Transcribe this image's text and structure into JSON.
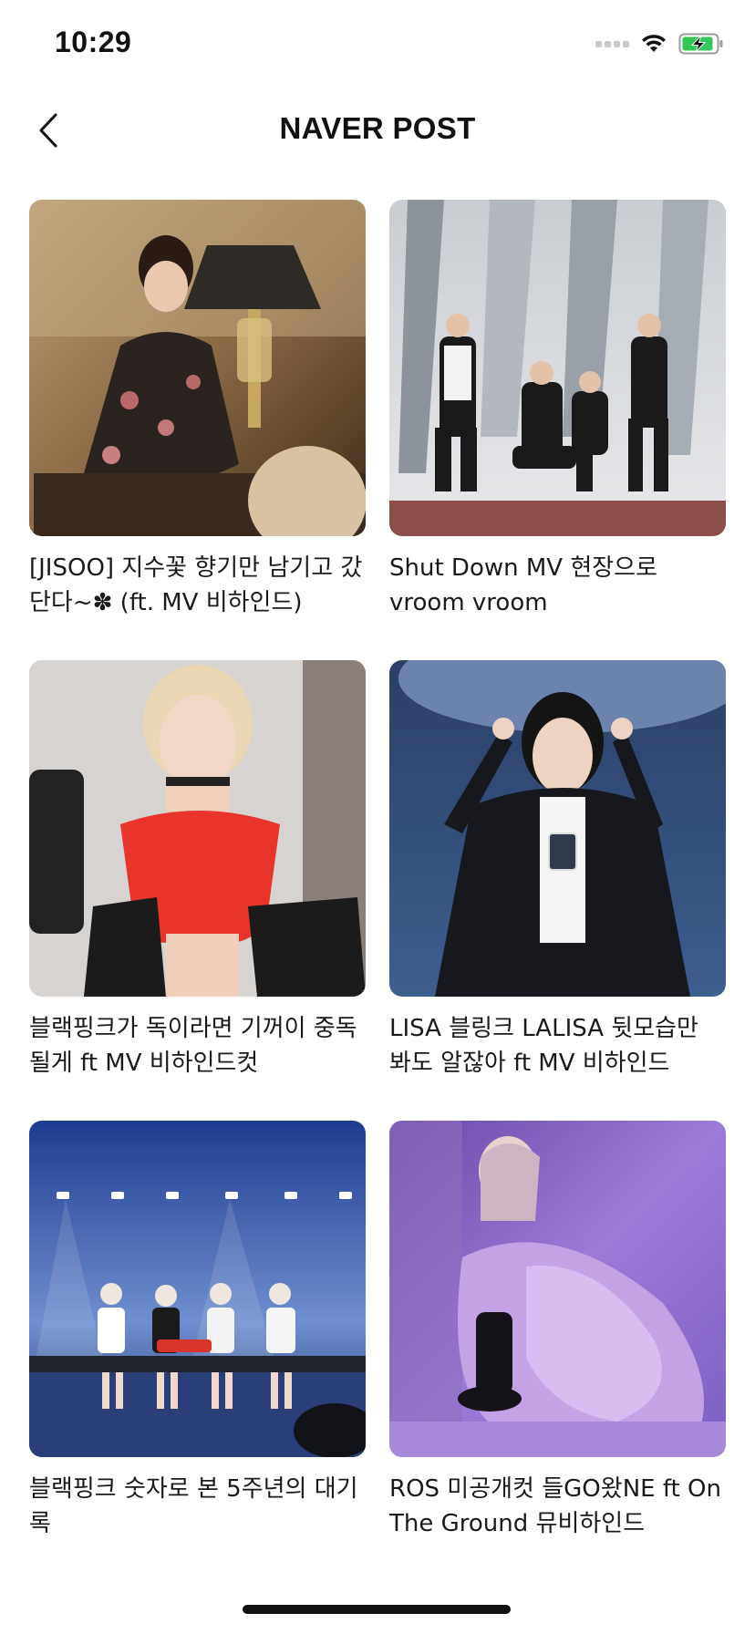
{
  "status_bar": {
    "time": "10:29"
  },
  "header": {
    "title": "NAVER POST",
    "back_icon": "chevron-left-icon"
  },
  "posts": [
    {
      "caption": "[JISOO] 지수꽃 향기만 남기고 갔단다~✽ (ft. MV 비하인드)",
      "image": "woman in floral dress with lamp and cat"
    },
    {
      "caption": "Shut Down MV 현장으로 vroom vroom",
      "image": "four women posing on stage set"
    },
    {
      "caption": "블랙핑크가 독이라면 기꺼이 중독될게 ft MV 비하인드컷",
      "image": "blonde woman in red corset top"
    },
    {
      "caption": "LISA 블링크 LALISA 뒷모습만 봐도 알잖아 ft MV 비하인드",
      "image": "woman in black suit making hand signs"
    },
    {
      "caption": "블랙핑크 숫자로 본 5주년의 대기록",
      "image": "four women sitting on concert stage"
    },
    {
      "caption": "ROS 미공개컷 들GO왔NE ft On The Ground 뮤비하인드",
      "image": "woman in purple tulle dress"
    }
  ],
  "colors": {
    "battery_green": "#35c759",
    "text": "#1a1a1a"
  }
}
